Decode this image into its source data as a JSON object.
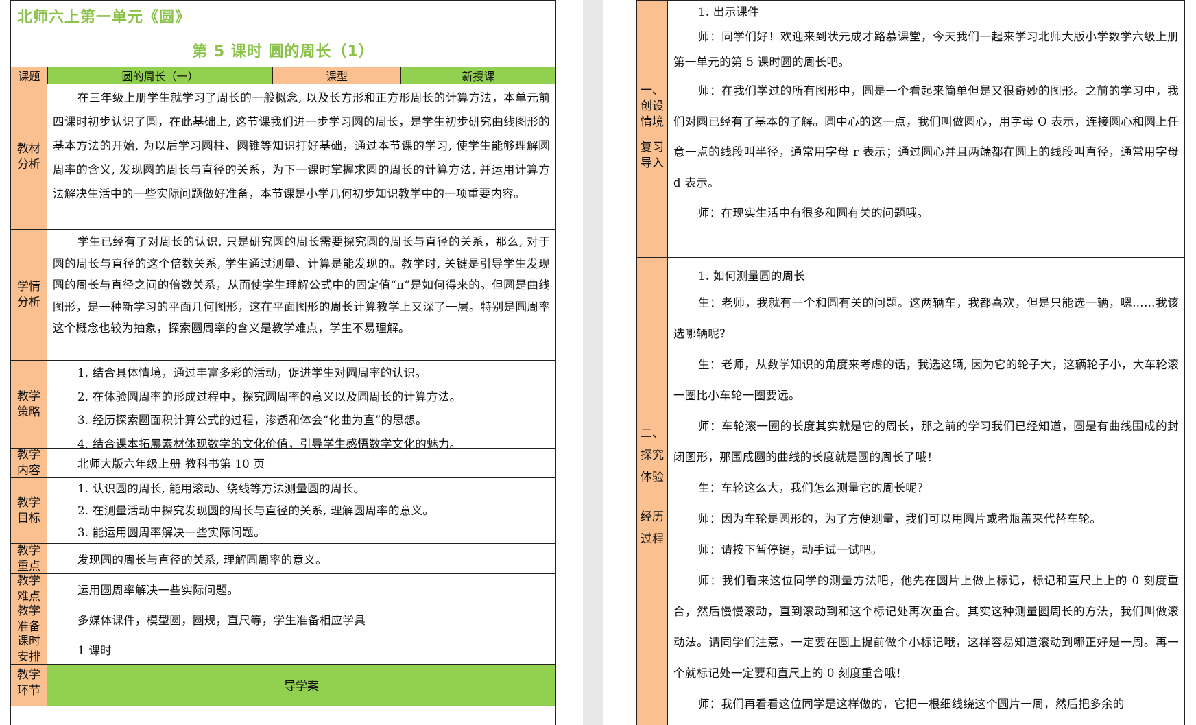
{
  "doc": {
    "unit_title": "北师六上第一单元《圆》",
    "lesson_title": "第 5 课时 圆的周长（1）"
  },
  "info": {
    "topic_label": "课题",
    "topic_value": "圆的周长（一）",
    "type_label": "课型",
    "type_value": "新授课"
  },
  "left_rows": {
    "textbook": {
      "label": "教材\n分析",
      "text": "在三年级上册学生就学习了周长的一般概念, 以及长方形和正方形周长的计算方法，本单元前四课时初步认识了圆，在此基础上, 这节课我们进一步学习圆的周长，是学生初步研究曲线图形的基本方法的开始, 为以后学习圆柱、圆锥等知识打好基础，通过本节课的学习, 使学生能够理解圆周率的含义, 发现圆的周长与直径的关系，为下一课时掌握求圆的周长的计算方法, 并运用计算方法解决生活中的一些实际问题做好准备，本节课是小学几何初步知识教学中的一项重要内容。"
    },
    "students": {
      "label": "学情\n分析",
      "text": "学生已经有了对周长的认识, 只是研究圆的周长需要探究圆的周长与直径的关系，那么, 对于圆的周长与直径的这个倍数关系, 学生通过测量、计算是能发现的。教学时, 关键是引导学生发现圆的周长与直径之间的倍数关系，从而使学生理解公式中的固定值“π”是如何得来的。但圆是曲线图形，是一种新学习的平面几何图形，这在平面图形的周长计算教学上又深了一层。特别是圆周率这个概念也较为抽象，探索圆周率的含义是教学难点，学生不易理解。"
    },
    "strategy": {
      "label": "教学\n策略",
      "items": [
        "1. 结合具体情境，通过丰富多彩的活动，促进学生对圆周率的认识。",
        "2. 在体验圆周率的形成过程中，探究圆周率的意义以及圆周长的计算方法。",
        "3. 经历探索圆面积计算公式的过程，渗透和体会“化曲为直”的思想。",
        "4. 结合课本拓展素材体现数学的文化价值，引导学生感悟数学文化的魅力。"
      ]
    },
    "content": {
      "label": "教学\n内容",
      "text": "北师大版六年级上册  教科书第 10 页"
    },
    "goals": {
      "label": "教学\n目标",
      "items": [
        "1. 认识圆的周长, 能用滚动、绕线等方法测量圆的周长。",
        "2. 在测量活动中探究发现圆的周长与直径的关系, 理解圆周率的意义。",
        "3. 能运用圆周率解决一些实际问题。"
      ]
    },
    "key": {
      "label": "教学\n重点",
      "text": "发现圆的周长与直径的关系, 理解圆周率的意义。"
    },
    "difficulty": {
      "label": "教学\n难点",
      "text": "运用圆周率解决一些实际问题。"
    },
    "prep": {
      "label": "教学\n准备",
      "text": "多媒体课件，模型圆，圆规，直尺等，学生准备相应学具"
    },
    "time": {
      "label": "课时\n安排",
      "text": "1 课时"
    },
    "guide": {
      "label": "教学\n环节",
      "text": "导学案"
    }
  },
  "right_rows": {
    "section1": {
      "label_a": "一、\n创设\n情境",
      "label_b": "复习\n导入",
      "heading": "1.  出示课件",
      "paragraphs": [
        "师：同学们好！欢迎来到状元成才路慕课堂，今天我们一起来学习北师大版小学数学六级上册第一单元的第 5 课时圆的周长吧。",
        "师：在我们学过的所有图形中，圆是一个看起来简单但是又很奇妙的图形。之前的学习中，我们对圆已经有了基本的了解。圆中心的这一点，我们叫做圆心，用字母 O 表示，连接圆心和圆上任意一点的线段叫半径，通常用字母 r 表示；通过圆心并且两端都在圆上的线段叫直径，通常用字母 d 表示。",
        "师：在现实生活中有很多和圆有关的问题哦。"
      ]
    },
    "section2": {
      "label_a": "二、\n探究\n体验",
      "label_b": "经历\n过程",
      "heading": "1. 如何测量圆的周长",
      "paragraphs": [
        "生：老师，我就有一个和圆有关的问题。这两辆车，我都喜欢，但是只能选一辆，嗯……我该选哪辆呢？",
        "生：老师，从数学知识的角度来考虑的话，我选这辆, 因为它的轮子大，这辆轮子小，大车轮滚一圈比小车轮一圈要远。",
        "师：车轮滚一圈的长度其实就是它的周长，那之前的学习我们已经知道，圆是有曲线围成的封闭图形，那围成圆的曲线的长度就是圆的周长了哦！",
        "生：车轮这么大，我们怎么测量它的周长呢？",
        "师：因为车轮是圆形的，为了方便测量，我们可以用圆片或者瓶盖来代替车轮。",
        "师：请按下暂停键，动手试一试吧。",
        "师：我们看来这位同学的测量方法吧，他先在圆片上做上标记，标记和直尺上上的 0 刻度重合，然后慢慢滚动，直到滚动到和这个标记处再次重合。其实这种测量圆周长的方法，我们叫做滚动法。请同学们注意，一定要在圆上提前做个小标记哦，这样容易知道滚动到哪正好是一周。再一个就标记处一定要和直尺上的 0 刻度重合哦！",
        "师：我们再看看这位同学是这样做的，它把一根细线绕这个圆片一周，然后把多余的"
      ]
    }
  }
}
